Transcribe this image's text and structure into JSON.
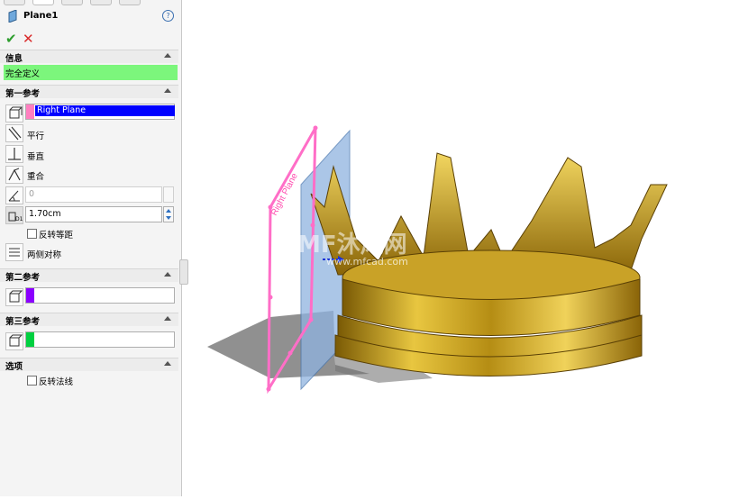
{
  "feature": {
    "title": "Plane1",
    "help": "?"
  },
  "actions": {
    "ok": "✔",
    "cancel": "✕"
  },
  "info": {
    "header": "信息",
    "status": "完全定义"
  },
  "first_ref": {
    "header": "第一参考",
    "selection": "Right Plane",
    "options": [
      "平行",
      "垂直",
      "重合"
    ],
    "angle_value": "0",
    "distance_value": "1.70cm",
    "flip_offset": "反转等距",
    "symmetric": "两侧对称"
  },
  "second_ref": {
    "header": "第二参考"
  },
  "third_ref": {
    "header": "第三参考"
  },
  "options": {
    "header": "选项",
    "flip_normal": "反转法线"
  },
  "watermark": {
    "logo": "MF沐风网",
    "url": "www.mfcad.com"
  },
  "plane_preview_label": "Right Plane",
  "colors": {
    "status_green": "#7cf67c",
    "selection_pink": "#ff7fc0",
    "second_purple": "#8b00ff",
    "third_green": "#00d040",
    "plane_pink": "#ff6ec7",
    "plane_blue": "#8fb3e0",
    "gold": "#c9a227",
    "selection_blue": "#0000ff"
  }
}
